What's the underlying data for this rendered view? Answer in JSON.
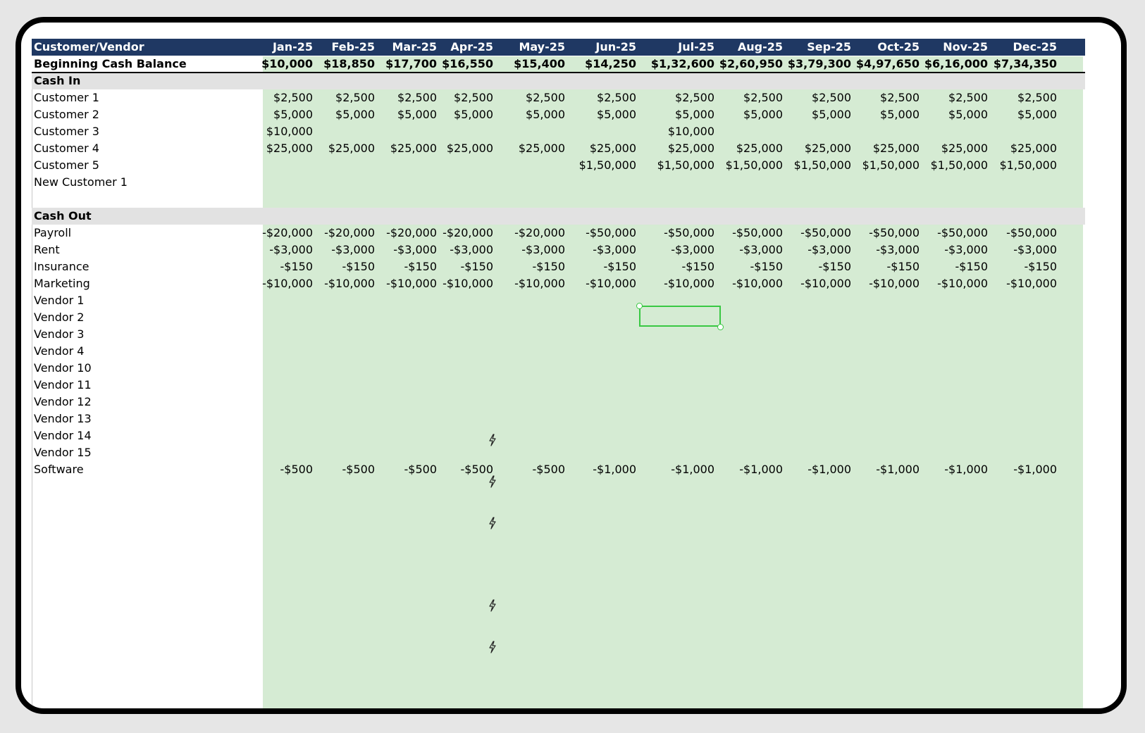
{
  "header": {
    "first_col": "Customer/Vendor",
    "months": [
      "Jan-25",
      "Feb-25",
      "Mar-25",
      "Apr-25",
      "May-25",
      "Jun-25",
      "Jul-25",
      "Aug-25",
      "Sep-25",
      "Oct-25",
      "Nov-25",
      "Dec-25"
    ]
  },
  "beginning_balance": {
    "label": "Beginning Cash Balance",
    "values": [
      "$10,000",
      "$18,850",
      "$17,700",
      "$16,550",
      "$15,400",
      "$14,250",
      "$1,32,600",
      "$2,60,950",
      "$3,79,300",
      "$4,97,650",
      "$6,16,000",
      "$7,34,350"
    ]
  },
  "cash_in": {
    "title": "Cash In",
    "rows": [
      {
        "label": "Customer 1",
        "values": [
          "$2,500",
          "$2,500",
          "$2,500",
          "$2,500",
          "$2,500",
          "$2,500",
          "$2,500",
          "$2,500",
          "$2,500",
          "$2,500",
          "$2,500",
          "$2,500"
        ]
      },
      {
        "label": "Customer 2",
        "values": [
          "$5,000",
          "$5,000",
          "$5,000",
          "$5,000",
          "$5,000",
          "$5,000",
          "$5,000",
          "$5,000",
          "$5,000",
          "$5,000",
          "$5,000",
          "$5,000"
        ]
      },
      {
        "label": "Customer 3",
        "values": [
          "$10,000",
          "",
          "",
          "",
          "",
          "",
          "$10,000",
          "",
          "",
          "",
          "",
          ""
        ]
      },
      {
        "label": "Customer 4",
        "values": [
          "$25,000",
          "$25,000",
          "$25,000",
          "$25,000",
          "$25,000",
          "$25,000",
          "$25,000",
          "$25,000",
          "$25,000",
          "$25,000",
          "$25,000",
          "$25,000"
        ]
      },
      {
        "label": "Customer 5",
        "values": [
          "",
          "",
          "",
          "",
          "",
          "$1,50,000",
          "$1,50,000",
          "$1,50,000",
          "$1,50,000",
          "$1,50,000",
          "$1,50,000",
          "$1,50,000"
        ]
      },
      {
        "label": "New Customer 1",
        "values": [
          "",
          "",
          "",
          "",
          "",
          "",
          "",
          "",
          "",
          "",
          "",
          ""
        ]
      }
    ]
  },
  "cash_out": {
    "title": "Cash Out",
    "rows": [
      {
        "label": "Payroll",
        "values": [
          "-$20,000",
          "-$20,000",
          "-$20,000",
          "-$20,000",
          "-$20,000",
          "-$50,000",
          "-$50,000",
          "-$50,000",
          "-$50,000",
          "-$50,000",
          "-$50,000",
          "-$50,000"
        ]
      },
      {
        "label": "Rent",
        "values": [
          "-$3,000",
          "-$3,000",
          "-$3,000",
          "-$3,000",
          "-$3,000",
          "-$3,000",
          "-$3,000",
          "-$3,000",
          "-$3,000",
          "-$3,000",
          "-$3,000",
          "-$3,000"
        ]
      },
      {
        "label": "Insurance",
        "values": [
          "-$150",
          "-$150",
          "-$150",
          "-$150",
          "-$150",
          "-$150",
          "-$150",
          "-$150",
          "-$150",
          "-$150",
          "-$150",
          "-$150"
        ]
      },
      {
        "label": "Marketing",
        "values": [
          "-$10,000",
          "-$10,000",
          "-$10,000",
          "-$10,000",
          "-$10,000",
          "-$10,000",
          "-$10,000",
          "-$10,000",
          "-$10,000",
          "-$10,000",
          "-$10,000",
          "-$10,000"
        ]
      },
      {
        "label": "Vendor 1",
        "values": [
          "",
          "",
          "",
          "",
          "",
          "",
          "",
          "",
          "",
          "",
          "",
          ""
        ]
      },
      {
        "label": "Vendor 2",
        "values": [
          "",
          "",
          "",
          "",
          "",
          "",
          "",
          "",
          "",
          "",
          "",
          ""
        ]
      },
      {
        "label": "Vendor 3",
        "values": [
          "",
          "",
          "",
          "",
          "",
          "",
          "",
          "",
          "",
          "",
          "",
          ""
        ]
      },
      {
        "label": "Vendor 4",
        "values": [
          "",
          "",
          "",
          "",
          "",
          "",
          "",
          "",
          "",
          "",
          "",
          ""
        ]
      },
      {
        "label": "Vendor 10",
        "values": [
          "",
          "",
          "",
          "",
          "",
          "",
          "",
          "",
          "",
          "",
          "",
          ""
        ]
      },
      {
        "label": "Vendor 11",
        "values": [
          "",
          "",
          "",
          "",
          "",
          "",
          "",
          "",
          "",
          "",
          "",
          ""
        ]
      },
      {
        "label": "Vendor 12",
        "values": [
          "",
          "",
          "",
          "",
          "",
          "",
          "",
          "",
          "",
          "",
          "",
          ""
        ]
      },
      {
        "label": "Vendor 13",
        "values": [
          "",
          "",
          "",
          "",
          "",
          "",
          "",
          "",
          "",
          "",
          "",
          ""
        ]
      },
      {
        "label": "Vendor 14",
        "values": [
          "",
          "",
          "",
          "",
          "",
          "",
          "",
          "",
          "",
          "",
          "",
          ""
        ]
      },
      {
        "label": "Vendor 15",
        "values": [
          "",
          "",
          "",
          "",
          "",
          "",
          "",
          "",
          "",
          "",
          "",
          ""
        ]
      },
      {
        "label": "Software",
        "values": [
          "-$500",
          "-$500",
          "-$500",
          "-$500",
          "-$500",
          "-$1,000",
          "-$1,000",
          "-$1,000",
          "-$1,000",
          "-$1,000",
          "-$1,000",
          "-$1,000"
        ]
      }
    ]
  },
  "icons": {
    "bolt": "lightning-bolt-icon"
  },
  "colors": {
    "header_bg": "#1f3863",
    "cell_green": "#d5ebd3",
    "section_gray": "#e2e2e2",
    "selection": "#39c843"
  }
}
